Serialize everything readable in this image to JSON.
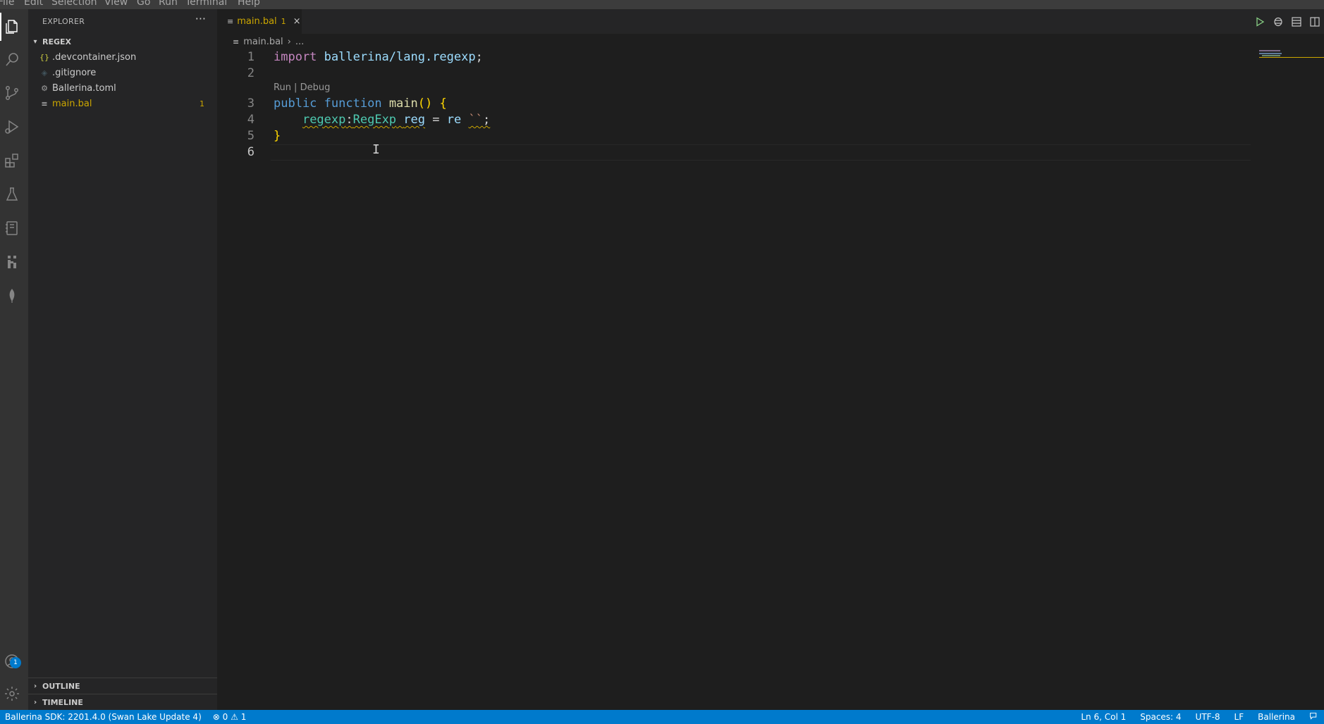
{
  "menu": [
    "File",
    "Edit",
    "Selection",
    "View",
    "Go",
    "Run",
    "Terminal",
    "Help"
  ],
  "activity_bar": {
    "icons": [
      "explorer-icon",
      "search-icon",
      "source-control-icon",
      "run-debug-icon",
      "extensions-icon",
      "testing-icon",
      "notebook-icon",
      "ballerina-icon",
      "leaf-icon"
    ],
    "accounts_badge": "1"
  },
  "sidebar": {
    "title": "EXPLORER",
    "more": "···",
    "folder": "REGEX",
    "files": [
      {
        "icon": "{}",
        "name": ".devcontainer.json",
        "badge": ""
      },
      {
        "icon": "◈",
        "name": ".gitignore",
        "badge": ""
      },
      {
        "icon": "⚙",
        "name": "Ballerina.toml",
        "badge": ""
      },
      {
        "icon": "≡",
        "name": "main.bal",
        "badge": "1"
      }
    ],
    "outline": "OUTLINE",
    "timeline": "TIMELINE"
  },
  "tab": {
    "name": "main.bal",
    "badge": "1",
    "close": "×"
  },
  "breadcrumb": {
    "file": "main.bal",
    "sep": "›",
    "more": "..."
  },
  "editor": {
    "line_numbers": [
      "1",
      "2",
      "3",
      "4",
      "5",
      "6"
    ],
    "codelens": "Run | Debug",
    "line1": {
      "kw": "import",
      "mod": "ballerina/lang.regexp",
      "semi": ";"
    },
    "line3": {
      "kw1": "public",
      "kw2": "function",
      "fn": "main",
      "parens": "()",
      "brace": "{"
    },
    "line4": {
      "mod": "regexp",
      "colon": ":",
      "type": "RegExp",
      "var": "reg",
      "eq": "=",
      "tag": "re",
      "tpl": "``",
      "semi": ";"
    },
    "line5": {
      "brace": "}"
    }
  },
  "status": {
    "sdk": "Ballerina SDK: 2201.4.0 (Swan Lake Update 4)",
    "errors": "0",
    "warnings": "1",
    "position": "Ln 6, Col 1",
    "spaces": "Spaces: 4",
    "encoding": "UTF-8",
    "eol": "LF",
    "language": "Ballerina"
  }
}
